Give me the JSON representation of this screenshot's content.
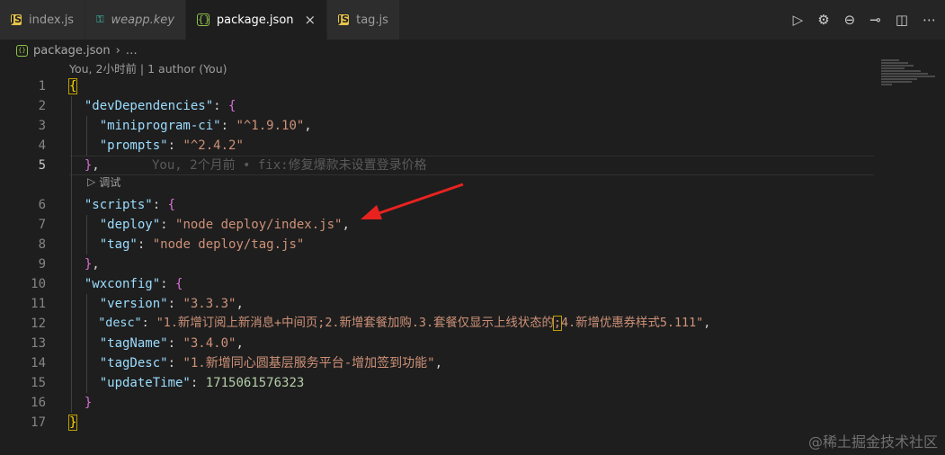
{
  "tabs": [
    {
      "label": "index.js",
      "kind": "js",
      "active": false
    },
    {
      "label": "weapp.key",
      "kind": "key",
      "active": false
    },
    {
      "label": "package.json",
      "kind": "json",
      "active": true
    },
    {
      "label": "tag.js",
      "kind": "js",
      "active": false
    }
  ],
  "tab_badges": {
    "js": "JS",
    "json": "{}"
  },
  "tab_close": "×",
  "tab_action_icons": [
    "run-icon",
    "debug-icon",
    "git-compare-icon",
    "git-branch-icon",
    "split-editor-icon",
    "more-icon"
  ],
  "breadcrumb": {
    "file": "package.json",
    "separator": "›",
    "rest": "…"
  },
  "blame_header": "You, 2小时前 | 1 author (You)",
  "inline_blame": "You, 2个月前 • fix:修复爆款未设置登录价格",
  "codelens": {
    "icon": "play-icon",
    "label": "调试"
  },
  "line_numbers": [
    "1",
    "2",
    "3",
    "4",
    "5",
    "6",
    "7",
    "8",
    "9",
    "10",
    "11",
    "12",
    "13",
    "14",
    "15",
    "16",
    "17"
  ],
  "current_line": "5",
  "code": {
    "open_brace": "{",
    "dev_key": "\"devDependencies\"",
    "ci_key": "\"miniprogram-ci\"",
    "ci_val": "\"^1.9.10\"",
    "prompts_key": "\"prompts\"",
    "prompts_val": "\"^2.4.2\"",
    "scripts_key": "\"scripts\"",
    "deploy_key": "\"deploy\"",
    "deploy_val": "\"node deploy/index.js\"",
    "tag_key": "\"tag\"",
    "tag_val": "\"node deploy/tag.js\"",
    "wx_key": "\"wxconfig\"",
    "version_key": "\"version\"",
    "version_val": "\"3.3.3\"",
    "desc_key": "\"desc\"",
    "desc_val_a": "\"1.新增订阅上新消息+中间页;2.新增套餐加购.3.套餐仅显示上线状态的",
    "desc_val_sel": ";",
    "desc_val_b": "4.新增优惠券样式5.111\"",
    "tagname_key": "\"tagName\"",
    "tagname_val": "\"3.4.0\"",
    "tagdesc_key": "\"tagDesc\"",
    "tagdesc_val": "\"1.新增同心圆基层服务平台-增加签到功能\"",
    "update_key": "\"updateTime\"",
    "update_val": "1715061576323",
    "close_brace": "}"
  },
  "watermark": "@稀土掘金技术社区",
  "colors": {
    "background": "#1e1e1e",
    "key": "#9cdcfe",
    "string": "#ce9178",
    "number": "#b5cea8",
    "arrow": "#e8231f"
  }
}
